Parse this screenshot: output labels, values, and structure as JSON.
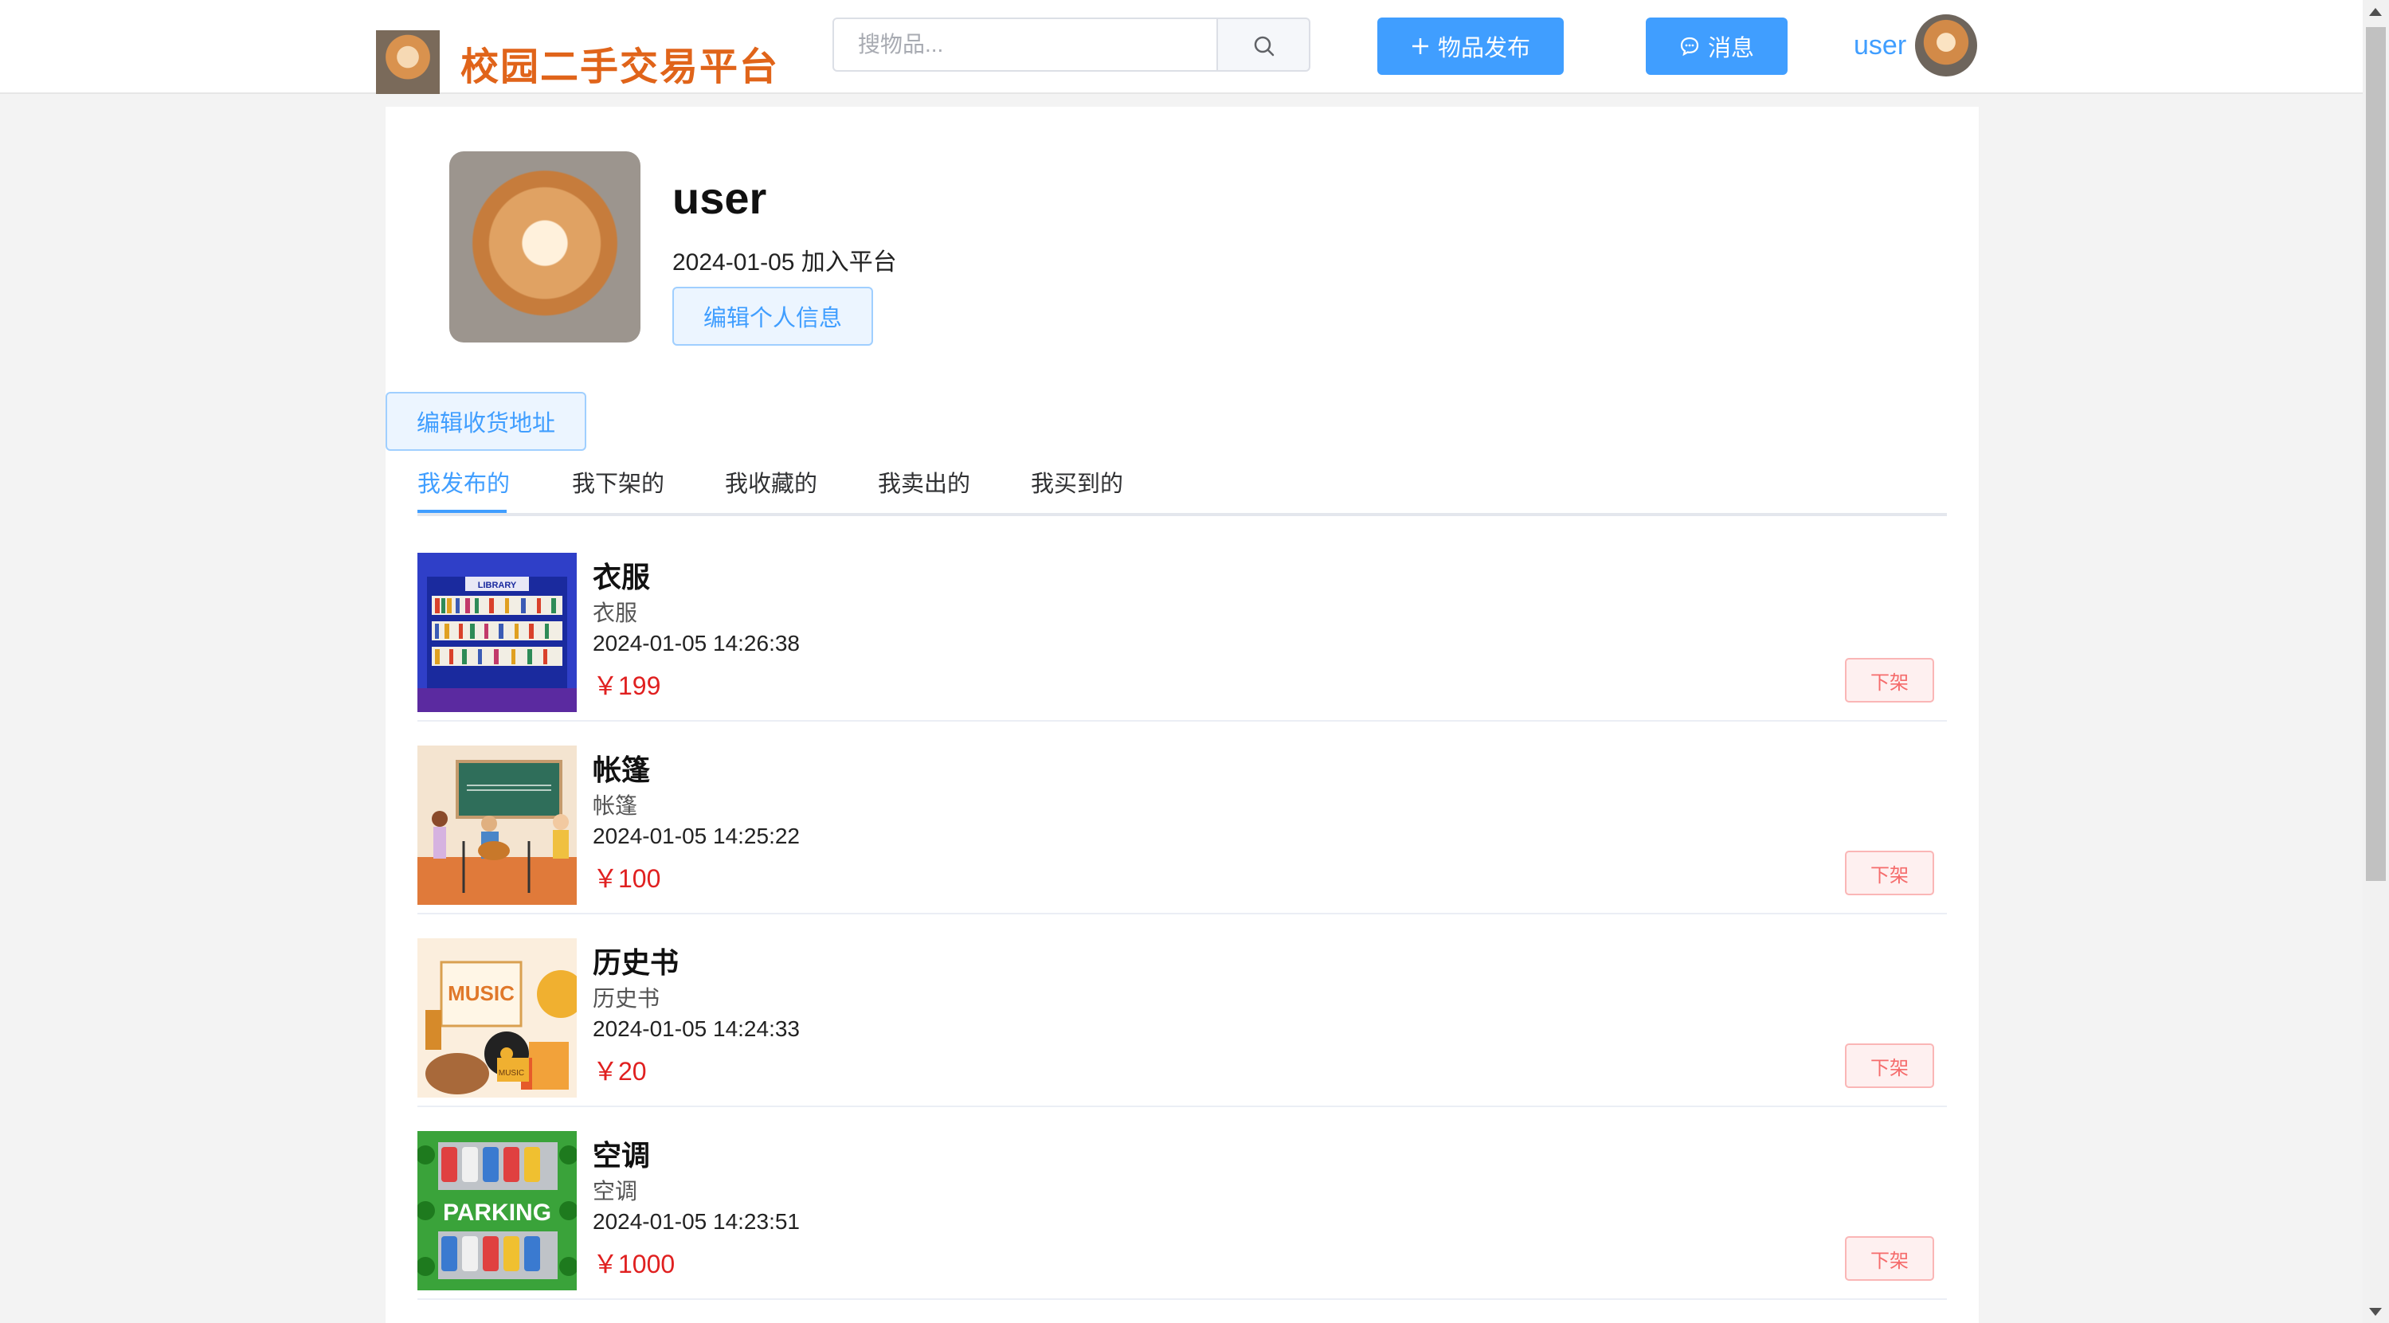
{
  "header": {
    "site_title": "校园二手交易平台",
    "search_placeholder": "搜物品...",
    "publish_label": "物品发布",
    "message_label": "消息",
    "username": "user"
  },
  "profile": {
    "name": "user",
    "join_text": "2024-01-05 加入平台",
    "edit_profile_label": "编辑个人信息",
    "edit_address_label": "编辑收货地址"
  },
  "tabs": [
    {
      "label": "我发布的",
      "active": true
    },
    {
      "label": "我下架的",
      "active": false
    },
    {
      "label": "我收藏的",
      "active": false
    },
    {
      "label": "我卖出的",
      "active": false
    },
    {
      "label": "我买到的",
      "active": false
    }
  ],
  "items": [
    {
      "title": "衣服",
      "desc": "衣服",
      "time": "2024-01-05 14:26:38",
      "price": "￥199",
      "image_sign": "LIBRARY",
      "action_label": "下架"
    },
    {
      "title": "帐篷",
      "desc": "帐篷",
      "time": "2024-01-05 14:25:22",
      "price": "￥100",
      "action_label": "下架"
    },
    {
      "title": "历史书",
      "desc": "历史书",
      "time": "2024-01-05 14:24:33",
      "price": "￥20",
      "image_sign": "MUSIC",
      "image_sign_small": "MUSIC",
      "action_label": "下架"
    },
    {
      "title": "空调",
      "desc": "空调",
      "time": "2024-01-05 14:23:51",
      "price": "￥1000",
      "image_sign": "PARKING",
      "action_label": "下架"
    }
  ],
  "colors": {
    "primary": "#409eff",
    "brand_title": "#e0641a",
    "price": "#e02020",
    "danger": "#f56c6c"
  },
  "icons": {
    "search": "search-icon",
    "plus": "plus-icon",
    "chat": "chat-icon"
  }
}
